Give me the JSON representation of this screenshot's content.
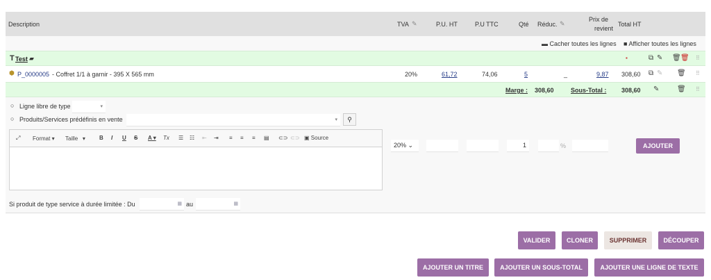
{
  "header": {
    "description": "Description",
    "tva": "TVA",
    "pu_ht": "P.U. HT",
    "pu_ttc": "P.U TTC",
    "qte": "Qté",
    "reduc": "Réduc.",
    "prix_revient_1": "Prix de",
    "prix_revient_2": "revient",
    "total_ht": "Total HT"
  },
  "toggles": {
    "hide": "Cacher toutes les lignes",
    "show": "Afficher toutes les lignes"
  },
  "title_row": {
    "label": "Test"
  },
  "product_row": {
    "ref": "P_0000005",
    "desc": " - Coffret 1/1 à garnir - 395 X 565 mm",
    "tva": "20%",
    "pu_ht": "61,72",
    "pu_ttc": "74,06",
    "qte": "5",
    "reduc": "_",
    "prix_revient": "9,87",
    "total_ht": "308,60"
  },
  "subtotal_row": {
    "marge_label": "Marge :",
    "marge": "308,60",
    "subtotal_label": "Sous-Total :",
    "subtotal": "308,60"
  },
  "form": {
    "free_line": "Ligne libre de type",
    "predefined": "Produits/Services prédéfinis en vente",
    "editor": {
      "format": "Format",
      "size": "Taille",
      "source": "Source"
    },
    "tva": "20%",
    "qty": "1",
    "pct": "%",
    "add": "AJOUTER",
    "service_label": "Si produit de type service à durée limitée : Du",
    "au": "au"
  },
  "actions": {
    "validate": "VALIDER",
    "clone": "CLONER",
    "delete": "SUPPRIMER",
    "cut": "DÉCOUPER",
    "add_title": "AJOUTER UN TITRE",
    "add_subtotal": "AJOUTER UN SOUS-TOTAL",
    "add_text": "AJOUTER UNE LIGNE DE TEXTE"
  }
}
